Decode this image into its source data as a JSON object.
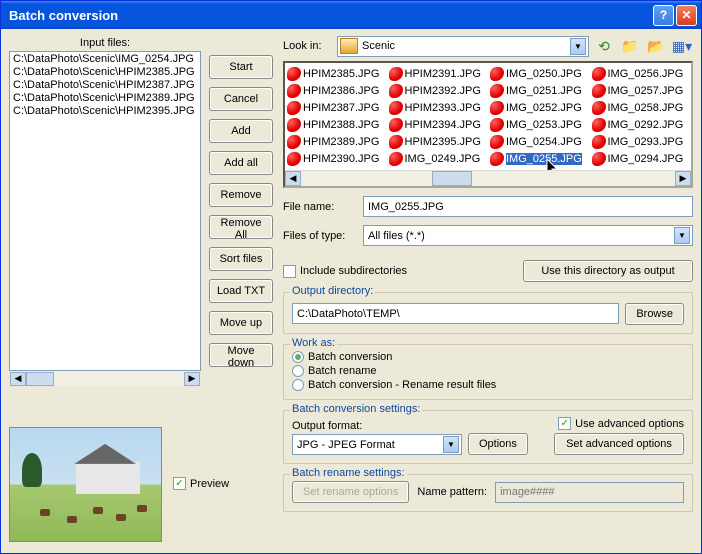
{
  "titlebar": {
    "title": "Batch conversion"
  },
  "left": {
    "label": "Input files:",
    "items": [
      "C:\\DataPhoto\\Scenic\\IMG_0254.JPG",
      "C:\\DataPhoto\\Scenic\\HPIM2385.JPG",
      "C:\\DataPhoto\\Scenic\\HPIM2387.JPG",
      "C:\\DataPhoto\\Scenic\\HPIM2389.JPG",
      "C:\\DataPhoto\\Scenic\\HPIM2395.JPG"
    ]
  },
  "buttons": {
    "start": "Start",
    "cancel": "Cancel",
    "add": "Add",
    "addall": "Add all",
    "remove": "Remove",
    "removeall": "Remove All",
    "sort": "Sort files",
    "loadtxt": "Load TXT",
    "moveup": "Move up",
    "movedown": "Move down"
  },
  "browser": {
    "lookin_label": "Look in:",
    "folder": "Scenic",
    "files_col1": [
      "HPIM2385.JPG",
      "HPIM2386.JPG",
      "HPIM2387.JPG",
      "HPIM2388.JPG",
      "HPIM2389.JPG",
      "HPIM2390.JPG"
    ],
    "files_col2": [
      "HPIM2391.JPG",
      "HPIM2392.JPG",
      "HPIM2393.JPG",
      "HPIM2394.JPG",
      "HPIM2395.JPG",
      "IMG_0249.JPG"
    ],
    "files_col3": [
      "IMG_0250.JPG",
      "IMG_0251.JPG",
      "IMG_0252.JPG",
      "IMG_0253.JPG",
      "IMG_0254.JPG",
      "IMG_0255.JPG"
    ],
    "files_col4": [
      "IMG_0256.JPG",
      "IMG_0257.JPG",
      "IMG_0258.JPG",
      "IMG_0292.JPG",
      "IMG_0293.JPG",
      "IMG_0294.JPG"
    ],
    "selected": "IMG_0255.JPG",
    "filename_label": "File name:",
    "filename_value": "IMG_0255.JPG",
    "filetype_label": "Files of type:",
    "filetype_value": "All files (*.*)"
  },
  "mid": {
    "include_sub": "Include subdirectories",
    "use_dir_output": "Use this directory as output",
    "outdir_label": "Output directory:",
    "outdir_value": "C:\\DataPhoto\\TEMP\\",
    "browse": "Browse"
  },
  "work": {
    "legend": "Work as:",
    "opt1": "Batch conversion",
    "opt2": "Batch rename",
    "opt3": "Batch conversion - Rename result files"
  },
  "conv": {
    "legend": "Batch conversion settings:",
    "outfmt_label": "Output format:",
    "outfmt_value": "JPG - JPEG Format",
    "options": "Options",
    "use_adv": "Use advanced options",
    "set_adv": "Set advanced options"
  },
  "rename": {
    "legend": "Batch rename settings:",
    "set_rename": "Set rename options",
    "pattern_label": "Name pattern:",
    "pattern_placeholder": "image####"
  },
  "preview": {
    "label": "Preview"
  }
}
